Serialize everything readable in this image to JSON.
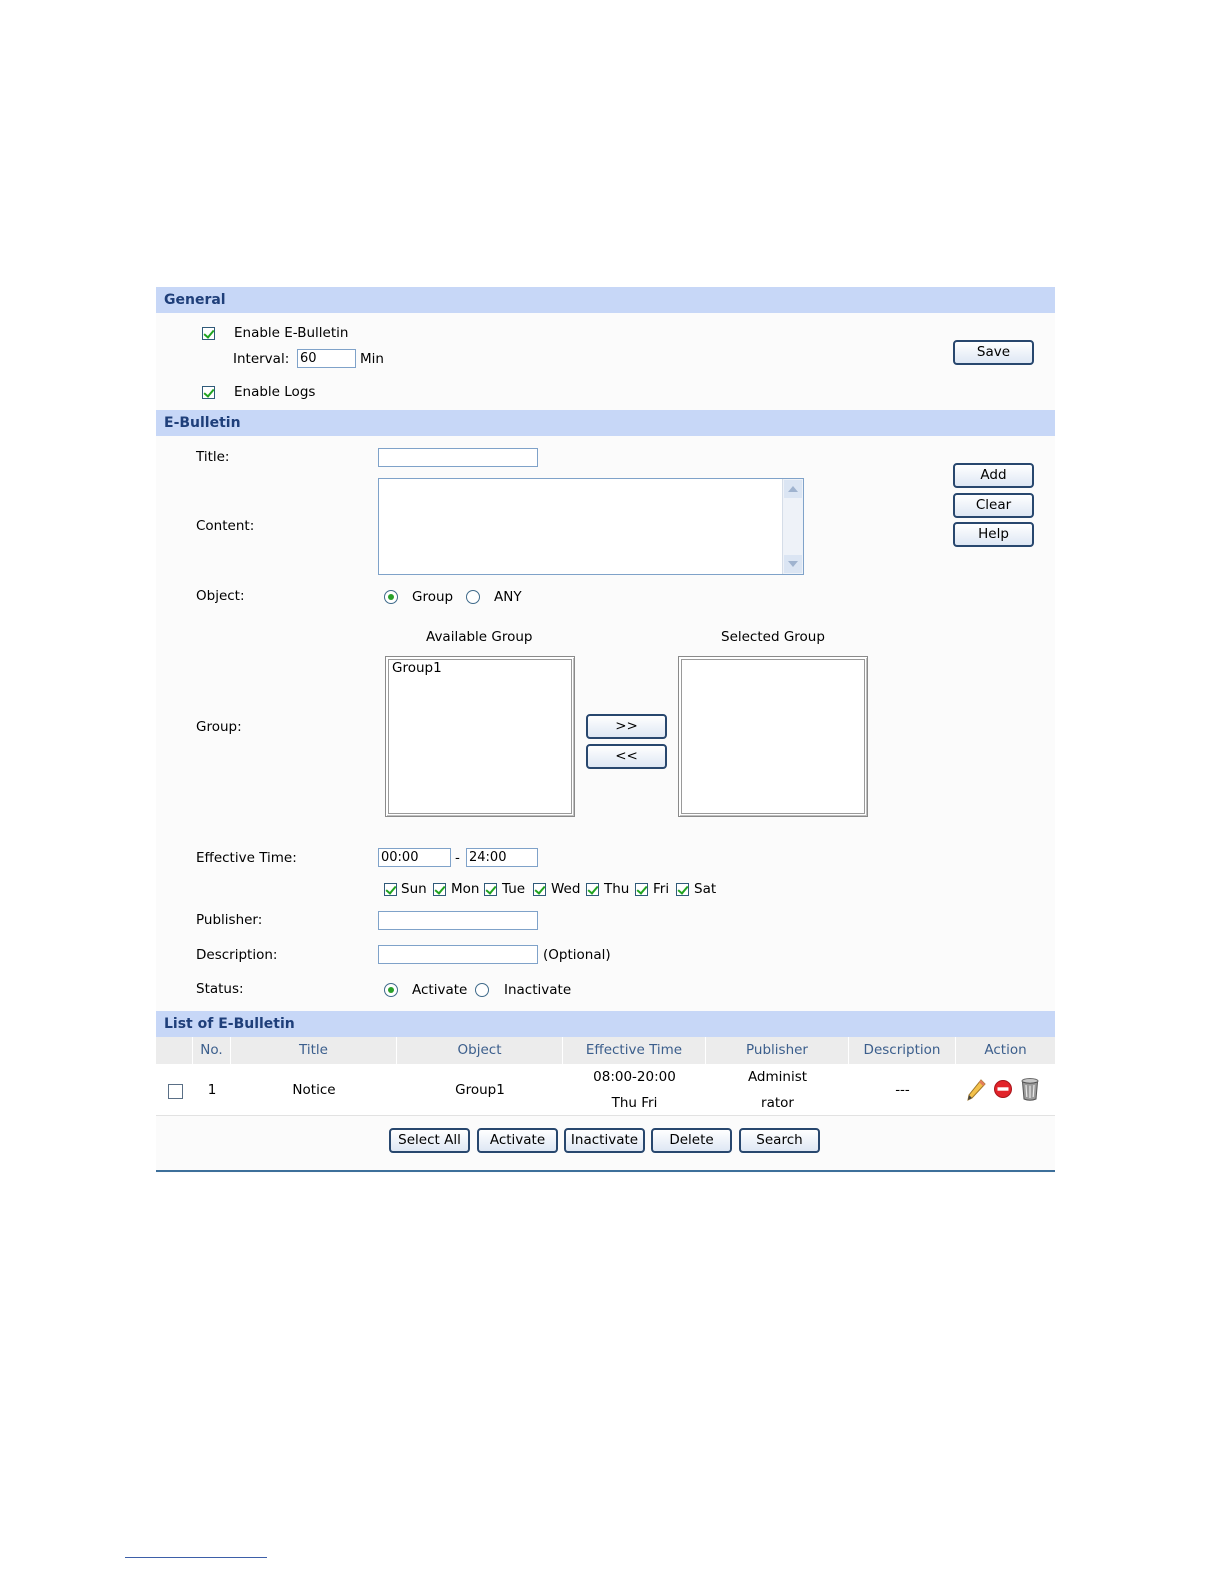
{
  "general": {
    "title": "General",
    "enable_ebulletin": {
      "label": "Enable E-Bulletin",
      "checked": true
    },
    "interval": {
      "label": "Interval:",
      "value": "60",
      "unit": "Min"
    },
    "enable_logs": {
      "label": "Enable Logs",
      "checked": true
    },
    "save_label": "Save"
  },
  "ebulletin": {
    "title": "E-Bulletin",
    "title_label": "Title:",
    "title_value": "",
    "content_label": "Content:",
    "content_value": "",
    "object_label": "Object:",
    "object_options": [
      "Group",
      "ANY"
    ],
    "object_selected": "Group",
    "group_label": "Group:",
    "available_group_label": "Available Group",
    "selected_group_label": "Selected Group",
    "available_groups": [
      "Group1"
    ],
    "selected_groups": [],
    "move_right_label": ">>",
    "move_left_label": "<<",
    "effective_time_label": "Effective Time:",
    "time_start": "00:00",
    "time_separator": "-",
    "time_end": "24:00",
    "days": [
      {
        "label": "Sun",
        "checked": true
      },
      {
        "label": "Mon",
        "checked": true
      },
      {
        "label": "Tue",
        "checked": true
      },
      {
        "label": "Wed",
        "checked": true
      },
      {
        "label": "Thu",
        "checked": true
      },
      {
        "label": "Fri",
        "checked": true
      },
      {
        "label": "Sat",
        "checked": true
      }
    ],
    "publisher_label": "Publisher:",
    "publisher_value": "",
    "description_label": "Description:",
    "description_value": "",
    "description_hint": "(Optional)",
    "status_label": "Status:",
    "status_options": [
      "Activate",
      "Inactivate"
    ],
    "status_selected": "Activate",
    "add_label": "Add",
    "clear_label": "Clear",
    "help_label": "Help"
  },
  "list": {
    "title": "List of E-Bulletin",
    "columns": [
      "No.",
      "Title",
      "Object",
      "Effective Time",
      "Publisher",
      "Description",
      "Action"
    ],
    "rows": [
      {
        "no": "1",
        "title": "Notice",
        "object": "Group1",
        "time_line1": "08:00-20:00",
        "time_line2": "Thu Fri",
        "publisher_line1": "Administ",
        "publisher_line2": "rator",
        "description": "---",
        "checked": false
      }
    ],
    "buttons": [
      "Select All",
      "Activate",
      "Inactivate",
      "Delete",
      "Search"
    ]
  },
  "colors": {
    "section_bar": "#c7d7f7",
    "section_text": "#1f3f7a",
    "check_mark": "#1fa31f",
    "button_border": "#28476e",
    "footer_rule": "#3d6f9a"
  }
}
